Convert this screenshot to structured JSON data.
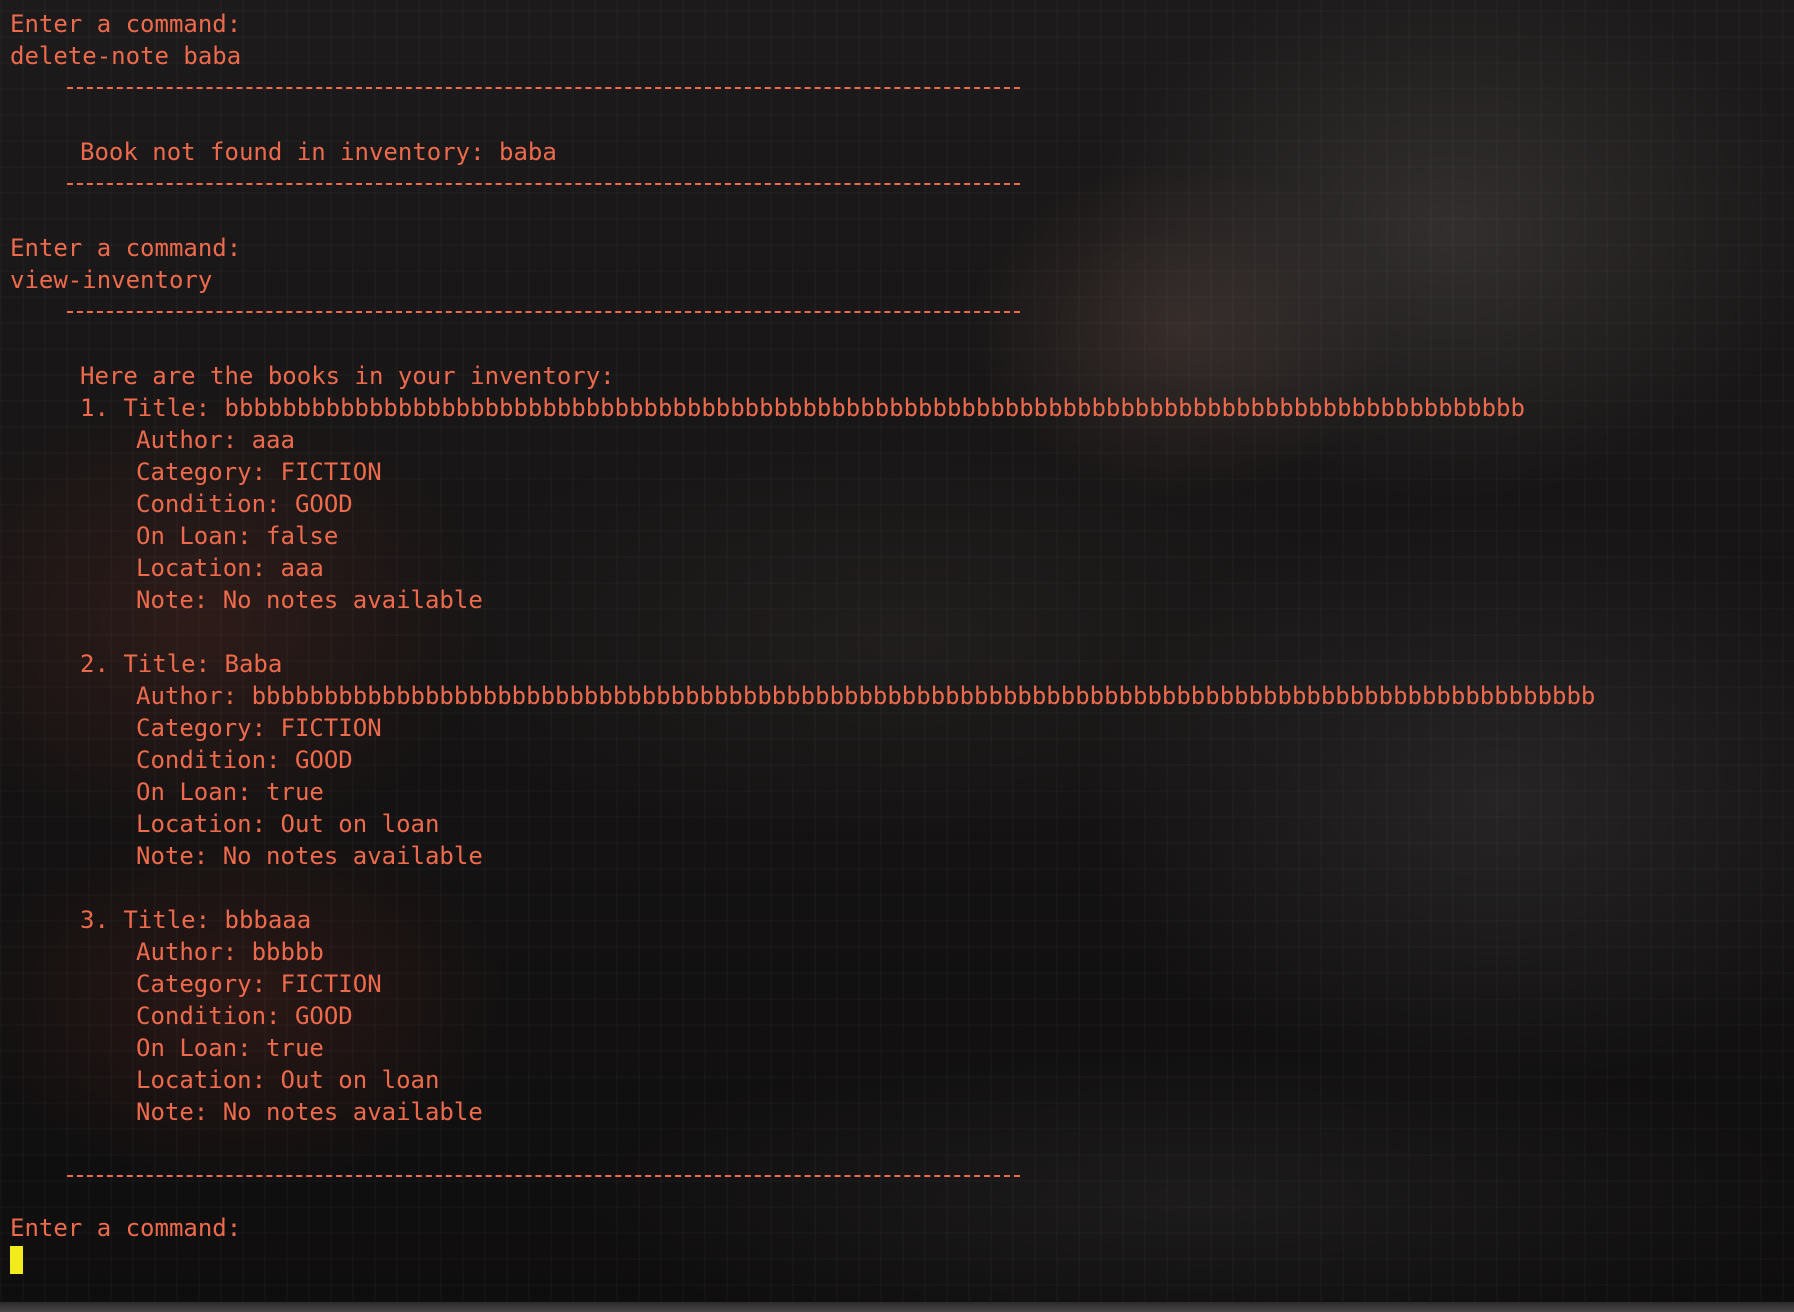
{
  "colors": {
    "text": "#ee6a4c",
    "cursor": "#f2ea1a",
    "background": "#141212"
  },
  "terminal": {
    "prompt_1": "Enter a command:",
    "command_1": "delete-note baba",
    "message_1": "Book not found in inventory: baba",
    "prompt_2": "Enter a command:",
    "command_2": "view-inventory",
    "inventory_header": "Here are the books in your inventory:",
    "books": [
      {
        "title_line": "1. Title: bbbbbbbbbbbbbbbbbbbbbbbbbbbbbbbbbbbbbbbbbbbbbbbbbbbbbbbbbbbbbbbbbbbbbbbbbbbbbbbbbbbbbbbbbb",
        "author": "Author: aaa",
        "category": "Category: FICTION",
        "condition": "Condition: GOOD",
        "on_loan": "On Loan: false",
        "location": "Location: aaa",
        "note": "Note: No notes available"
      },
      {
        "title_line": "2. Title: Baba",
        "author": "Author: bbbbbbbbbbbbbbbbbbbbbbbbbbbbbbbbbbbbbbbbbbbbbbbbbbbbbbbbbbbbbbbbbbbbbbbbbbbbbbbbbbbbbbbbbbbbb",
        "category": "Category: FICTION",
        "condition": "Condition: GOOD",
        "on_loan": "On Loan: true",
        "location": "Location: Out on loan",
        "note": "Note: No notes available"
      },
      {
        "title_line": "3. Title: bbbaaa",
        "author": "Author: bbbbb",
        "category": "Category: FICTION",
        "condition": "Condition: GOOD",
        "on_loan": "On Loan: true",
        "location": "Location: Out on loan",
        "note": "Note: No notes available"
      }
    ],
    "prompt_3": "Enter a command:",
    "current_input": ""
  }
}
